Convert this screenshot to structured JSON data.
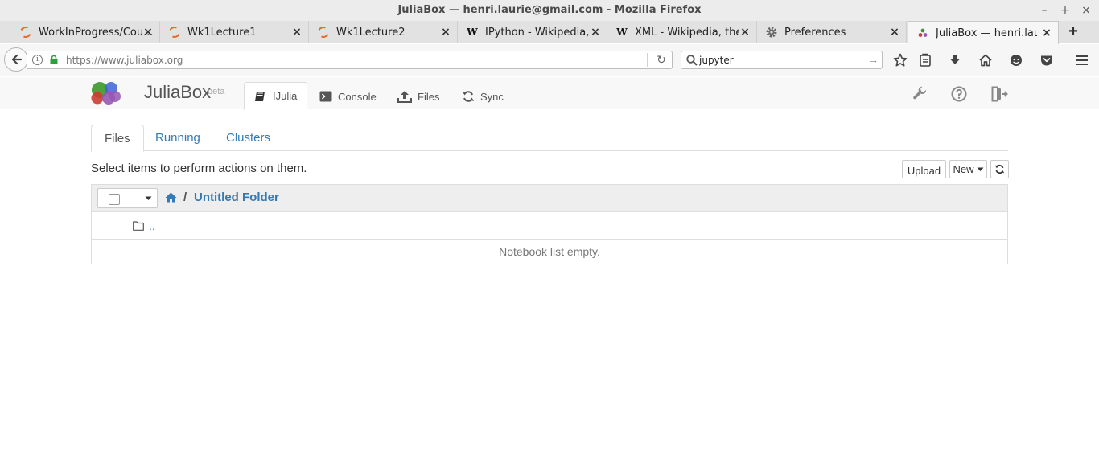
{
  "window": {
    "title": "JuliaBox — henri.laurie@gmail.com - Mozilla Firefox",
    "controls": {
      "minimize": "–",
      "maximize": "+",
      "close": "×"
    }
  },
  "tabs": [
    {
      "label": "WorkInProgress/Cou...",
      "icon": "jupyter-icon"
    },
    {
      "label": "Wk1Lecture1",
      "icon": "jupyter-icon"
    },
    {
      "label": "Wk1Lecture2",
      "icon": "jupyter-icon"
    },
    {
      "label": "IPython - Wikipedia, t...",
      "icon": "wikipedia-icon"
    },
    {
      "label": "XML - Wikipedia, the ...",
      "icon": "wikipedia-icon"
    },
    {
      "label": "Preferences",
      "icon": "gear-icon"
    },
    {
      "label": "JuliaBox — henri.laur...",
      "icon": "juliabox-icon"
    }
  ],
  "tab_close_glyph": "×",
  "new_tab_glyph": "+",
  "wiki_glyph": "W",
  "navbar": {
    "url": "https://www.juliabox.org",
    "search_value": "jupyter"
  },
  "juliabox": {
    "brand": "JuliaBox",
    "beta": "beta",
    "nav": [
      {
        "label": "IJulia"
      },
      {
        "label": "Console"
      },
      {
        "label": "Files"
      },
      {
        "label": "Sync"
      }
    ]
  },
  "files": {
    "subtabs": [
      "Files",
      "Running",
      "Clusters"
    ],
    "hint": "Select items to perform actions on them.",
    "upload_label": "Upload",
    "new_label": "New",
    "breadcrumb_sep": "/",
    "folder": "Untitled Folder",
    "parent_link": "..",
    "empty_message": "Notebook list empty."
  },
  "colors": {
    "link": "#337ab7",
    "jupyter_orange": "#e66b28"
  }
}
